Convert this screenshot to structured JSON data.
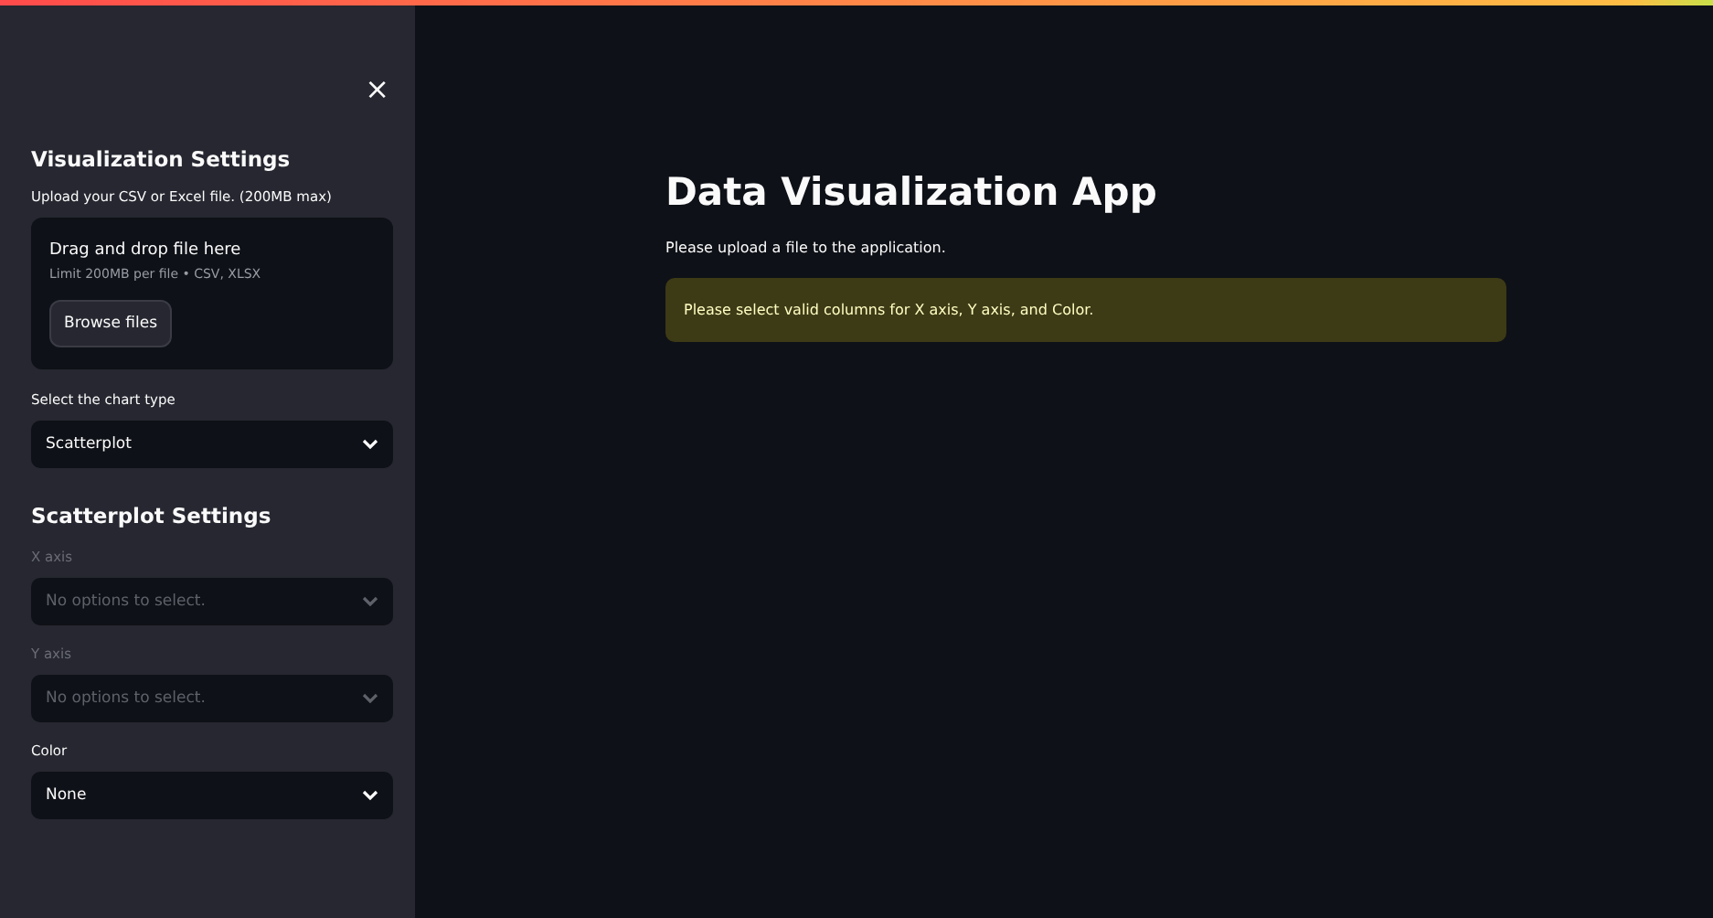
{
  "sidebar": {
    "close": "×",
    "title": "Visualization Settings",
    "uploader": {
      "label": "Upload your CSV or Excel file. (200MB max)",
      "drop_text": "Drag and drop file here",
      "limit": "Limit 200MB per file • CSV, XLSX",
      "button": "Browse files"
    },
    "chart_type": {
      "label": "Select the chart type",
      "value": "Scatterplot",
      "disabled": false
    },
    "section_title": "Scatterplot Settings",
    "selects": [
      {
        "label": "X axis",
        "placeholder": "No options to select.",
        "disabled": true
      },
      {
        "label": "Y axis",
        "placeholder": "No options to select.",
        "disabled": true
      },
      {
        "label": "Color",
        "value": "None",
        "disabled": false
      }
    ]
  },
  "main": {
    "title": "Data Visualization App",
    "text": "Please upload a file to the application.",
    "warning": "Please select valid columns for X axis, Y axis, and Color."
  }
}
